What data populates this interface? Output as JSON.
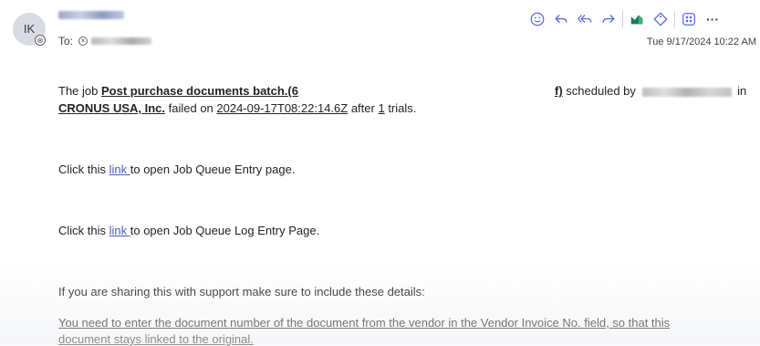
{
  "sender": {
    "initials": "IK"
  },
  "recipients": {
    "to_label": "To:"
  },
  "toolbar": {
    "icons": [
      "emoji-icon",
      "reply-icon",
      "reply-all-icon",
      "forward-icon",
      "viva-insights-icon",
      "tag-icon",
      "apps-icon",
      "more-icon"
    ],
    "more_label": "···"
  },
  "timestamp": "Tue 9/17/2024 10:22 AM",
  "message": {
    "line1_prefix": "The job ",
    "job_name": "Post purchase documents batch.(6",
    "sched_close": "f)",
    "sched_text": " scheduled by ",
    "sched_in": " in",
    "company": "CRONUS USA, Inc.",
    "failed_on": " failed on ",
    "datetime": "2024-09-17T08:22:14.6Z",
    "after": " after ",
    "trials_count": "1",
    "trials_suffix": " trials.",
    "click1_prefix": "Click this ",
    "click1_link": "link ",
    "click1_suffix": "to open Job Queue Entry page.",
    "click2_prefix": "Click this ",
    "click2_link": "link ",
    "click2_suffix": "to open Job Queue Log Entry Page.",
    "support_text": "If you are sharing this with support make sure to include these details:",
    "detail_line1": "You need to enter the document number of the document from the vendor in the Vendor Invoice No. field, so that this",
    "detail_line2": "document stays linked to the original."
  },
  "colors": {
    "link": "#4a5bc4",
    "toolbar_icon": "#5b6fd6",
    "insights_icon": "#1e7d53"
  }
}
